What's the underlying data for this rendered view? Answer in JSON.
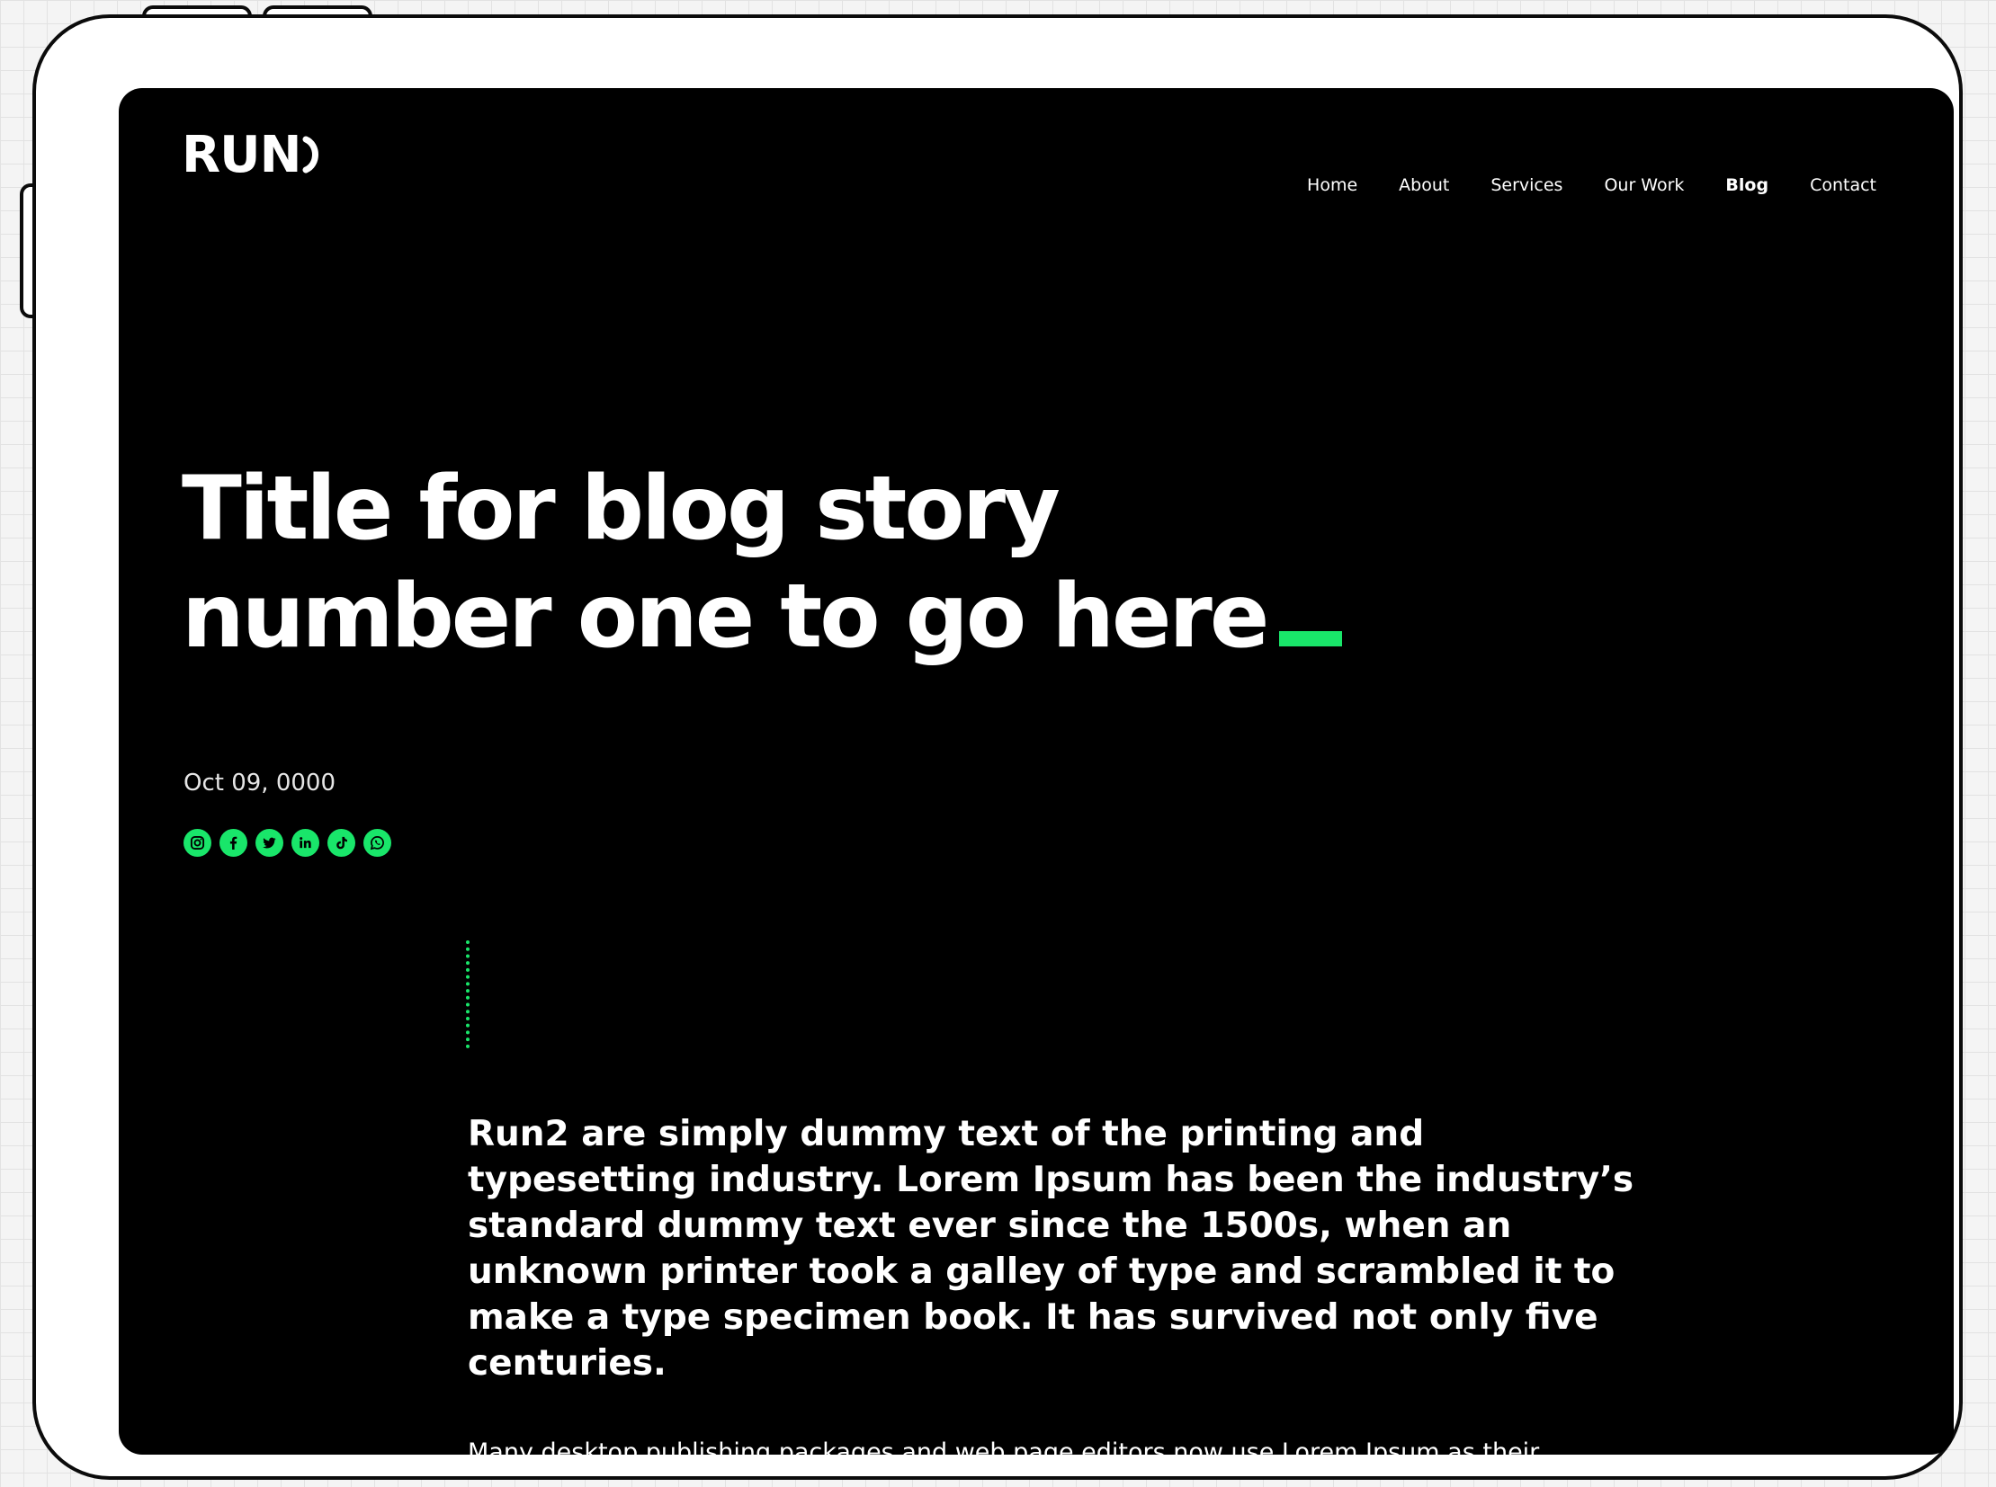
{
  "brand": {
    "logo_text": "RUN",
    "accent_color": "#19e66a",
    "background": "#000000"
  },
  "nav": {
    "items": [
      {
        "label": "Home"
      },
      {
        "label": "About"
      },
      {
        "label": "Services"
      },
      {
        "label": "Our Work"
      },
      {
        "label": "Blog",
        "active": true
      },
      {
        "label": "Contact"
      }
    ]
  },
  "post": {
    "title_line_1": "Title for blog story",
    "title_line_2": "number one to go here",
    "date": "Oct 09, 0000",
    "lead_lines": [
      "Run2 are simply dummy text of the printing and",
      "typesetting industry. Lorem Ipsum has been the industry’s",
      "standard dummy text ever since the 1500s, when an",
      "unknown printer took a galley of type and scrambled it to",
      "make a type specimen book. It has survived not only five",
      "centuries."
    ],
    "paragraph_2": "Many desktop publishing packages and web page editors now use Lorem Ipsum as their"
  },
  "social": {
    "icons": [
      "instagram-icon",
      "facebook-icon",
      "twitter-icon",
      "linkedin-icon",
      "tiktok-icon",
      "whatsapp-icon"
    ]
  }
}
